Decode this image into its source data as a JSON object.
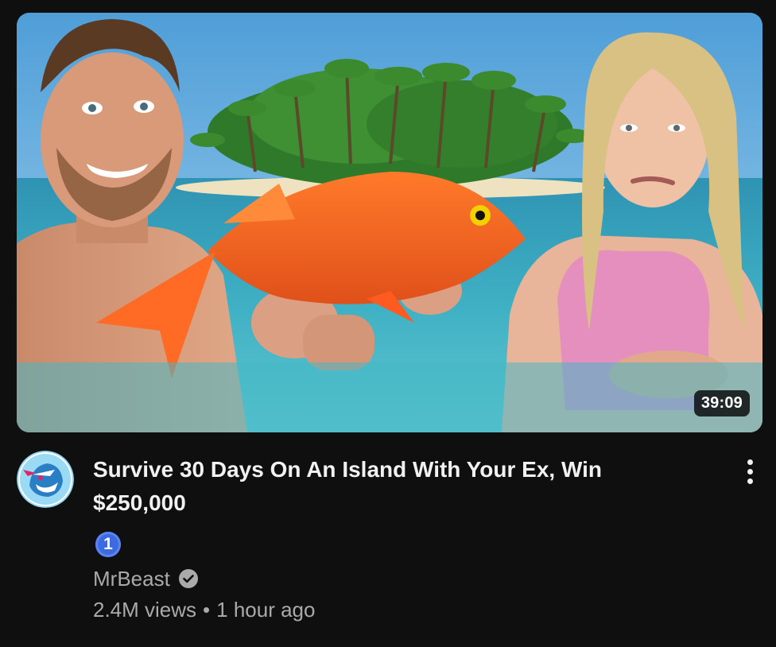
{
  "video": {
    "duration": "39:09",
    "title": "Survive 30 Days On An Island With Your Ex, Win $250,000",
    "rank": "1",
    "channel": "MrBeast",
    "views": "2.4M views",
    "separator": "•",
    "published": "1 hour ago"
  },
  "icons": {
    "verified": "verified-check-icon",
    "menu": "more-vert-icon",
    "avatar": "mrbeast-panther-logo"
  },
  "colors": {
    "background": "#0f0f0f",
    "title": "#f1f1f1",
    "secondary": "#aaaaaa",
    "badge": "#3e6ae1"
  }
}
